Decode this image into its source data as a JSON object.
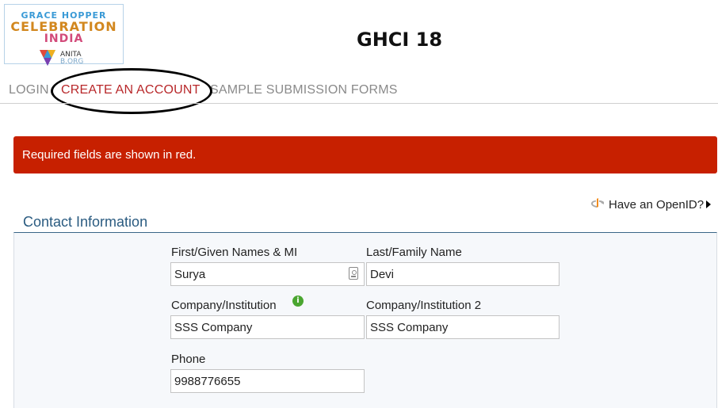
{
  "logo": {
    "line1": "GRACE HOPPER",
    "line2": "CELEBRATION",
    "line3": "INDIA",
    "org_line1": "ANITA",
    "org_line2": "B.ORG"
  },
  "page_title": "GHCI 18",
  "nav": {
    "login": "LOGIN",
    "create_account": "CREATE AN ACCOUNT",
    "sample_forms": "SAMPLE SUBMISSION FORMS"
  },
  "alert": {
    "text": "Required fields are shown in red."
  },
  "openid": {
    "label": "Have an OpenID?"
  },
  "contact": {
    "section_title": "Contact Information",
    "first_name": {
      "label": "First/Given Names & MI",
      "value": "Surya"
    },
    "last_name": {
      "label": "Last/Family Name",
      "value": "Devi"
    },
    "company": {
      "label": "Company/Institution",
      "value": "SSS Company"
    },
    "company2": {
      "label": "Company/Institution 2",
      "value": "SSS Company"
    },
    "phone": {
      "label": "Phone",
      "value": "9988776655"
    }
  },
  "colors": {
    "alert_bg": "#c72000",
    "active_nav": "#b8282a",
    "section_title": "#2a5b80",
    "info_icon": "#4aa630"
  }
}
